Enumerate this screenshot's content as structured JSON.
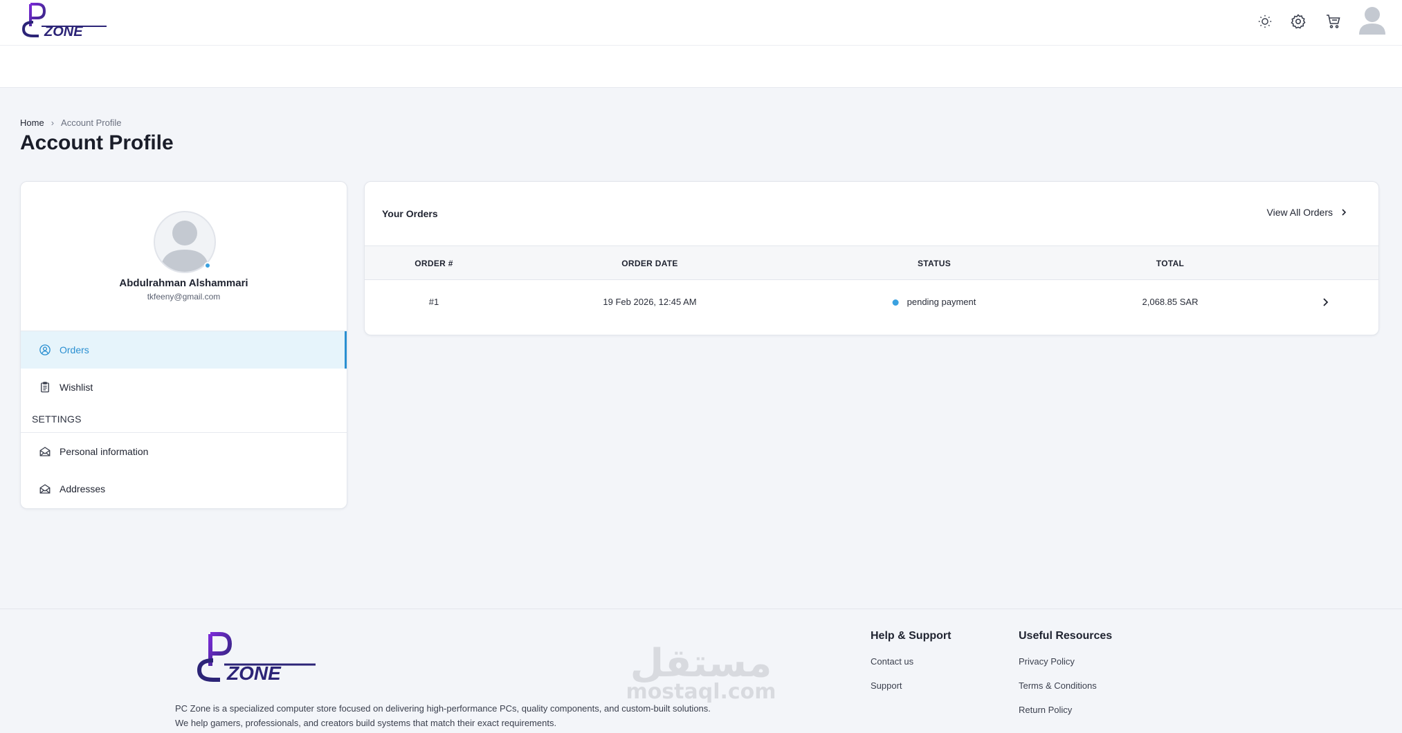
{
  "brand": {
    "logo_text": "PC ZONE",
    "accent_color": "#2a8fd1",
    "logo_color": "#2c2477"
  },
  "header": {
    "icons": [
      "sun-icon",
      "gear-icon",
      "cart-icon",
      "avatar"
    ]
  },
  "breadcrumb": {
    "home": "Home",
    "current": "Account Profile"
  },
  "page_title": "Account Profile",
  "profile": {
    "name": "Abdulrahman Alshammari",
    "email": "tkfeeny@gmail.com",
    "online": true
  },
  "sidebar": {
    "items": [
      {
        "label": "Orders",
        "icon": "user-circle-icon",
        "active": true
      },
      {
        "label": "Wishlist",
        "icon": "clipboard-icon",
        "active": false
      }
    ],
    "settings_label": "SETTINGS",
    "settings_items": [
      {
        "label": "Personal information",
        "icon": "envelope-open-icon"
      },
      {
        "label": "Addresses",
        "icon": "envelope-open-icon"
      }
    ]
  },
  "orders": {
    "title": "Your Orders",
    "view_all": "View All Orders",
    "columns": [
      "ORDER #",
      "ORDER DATE",
      "STATUS",
      "TOTAL"
    ],
    "rows": [
      {
        "order": "#1",
        "date": "19 Feb 2026, 12:45 AM",
        "status": "pending payment",
        "status_color": "#3aa1e0",
        "total": "2,068.85 SAR"
      }
    ]
  },
  "footer": {
    "description_line1": "PC Zone is a specialized computer store focused on delivering high-performance PCs, quality components, and custom-built solutions.",
    "description_line2": "We help gamers, professionals, and creators build systems that match their exact requirements.",
    "help": {
      "title": "Help & Support",
      "links": [
        "Contact us",
        "Support"
      ]
    },
    "resources": {
      "title": "Useful Resources",
      "links": [
        "Privacy Policy",
        "Terms & Conditions",
        "Return Policy"
      ]
    },
    "watermark_text": "مستقل",
    "watermark_sub": "mostaql.com"
  }
}
